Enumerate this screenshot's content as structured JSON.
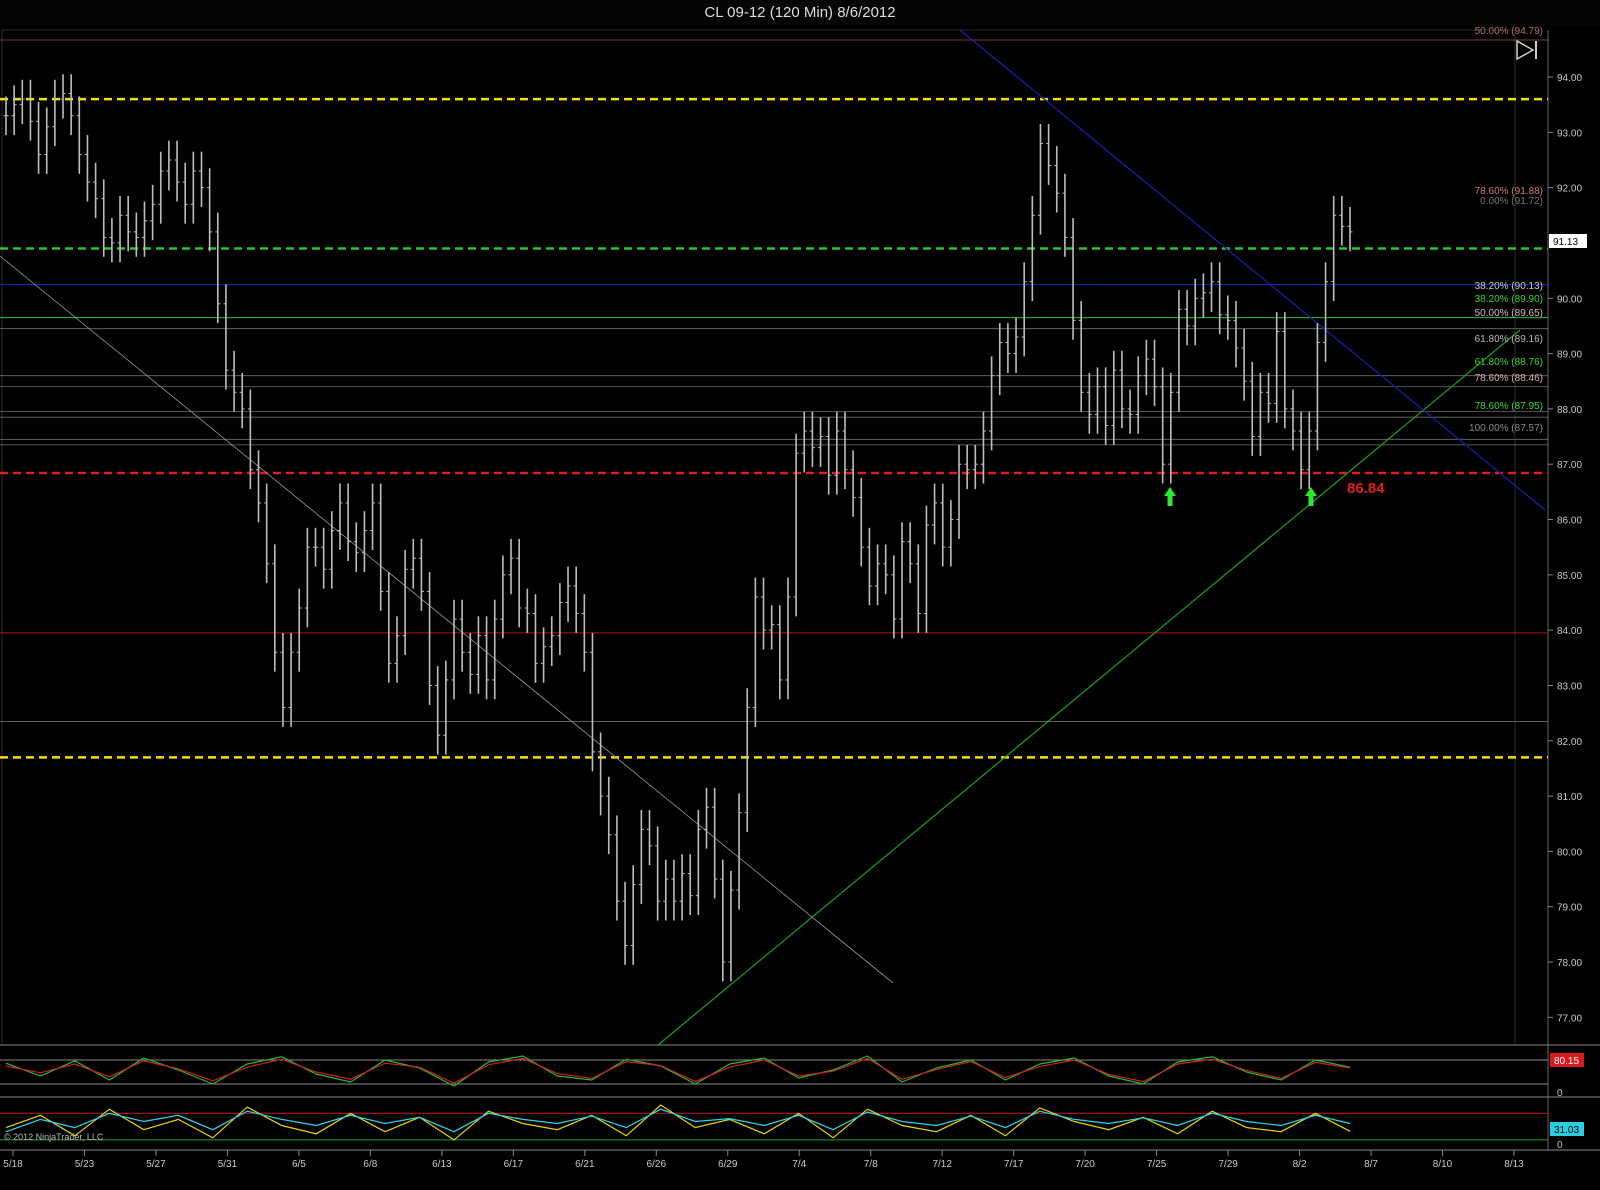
{
  "window": {
    "title": "CL 09-12 (120 Min)  8/6/2012"
  },
  "copyright": "© 2012 NinjaTrader, LLC",
  "price_label": "91.13",
  "support_label": "86.84",
  "colors": {
    "background": "#000000",
    "price_bars": "#bdbdbd",
    "resistance": "#f2e200",
    "support": "#e21b1b",
    "green_level": "#2ec22e",
    "blue_level": "#2020b8",
    "trend_up": "#19a319",
    "trend_down": "#1c1ca8",
    "stoch_k": "#2bb52b",
    "stoch_d": "#cc2222",
    "osc_yellow": "#e6d400",
    "osc_cyan": "#29d6e8"
  },
  "icons": {
    "up_arrow": "arrow-up-icon",
    "nav": "skip-forward-icon"
  },
  "chart_data": [
    {
      "type": "line",
      "title": "CL 09-12 (120 Min)  8/6/2012",
      "xlabel": "",
      "ylabel": "",
      "x_ticks": [
        "5/18",
        "5/23",
        "5/27",
        "5/31",
        "6/5",
        "6/8",
        "6/13",
        "6/17",
        "6/21",
        "6/26",
        "6/29",
        "7/4",
        "7/8",
        "7/12",
        "7/17",
        "7/20",
        "7/25",
        "7/29",
        "8/2",
        "8/7",
        "8/10",
        "8/13"
      ],
      "y_ticks": [
        "77.00",
        "78.00",
        "79.00",
        "80.00",
        "81.00",
        "82.00",
        "83.00",
        "84.00",
        "85.00",
        "86.00",
        "87.00",
        "88.00",
        "89.00",
        "90.00",
        "91.00",
        "92.00",
        "93.00",
        "94.00"
      ],
      "ylim": [
        76.5,
        94.85
      ],
      "current_price": 91.13,
      "series": [
        {
          "values": [
            93.3,
            93.5,
            93.6,
            93.2,
            92.6,
            93.1,
            93.6,
            93.7,
            93.3,
            92.6,
            92.1,
            91.8,
            91.1,
            91.0,
            91.5,
            91.2,
            91.1,
            91.4,
            91.7,
            92.3,
            92.5,
            92.1,
            91.7,
            92.3,
            92.0,
            91.2,
            89.9,
            88.7,
            88.3,
            88.0,
            86.9,
            86.3,
            85.2,
            83.6,
            82.6,
            83.6,
            84.4,
            85.5,
            85.5,
            85.1,
            85.8,
            86.3,
            85.6,
            85.4,
            85.8,
            86.3,
            84.7,
            83.4,
            83.9,
            85.1,
            85.3,
            84.7,
            83.0,
            82.1,
            83.1,
            84.2,
            83.6,
            83.2,
            83.9,
            83.1,
            84.2,
            85.0,
            85.3,
            84.4,
            84.3,
            83.4,
            83.7,
            83.9,
            84.5,
            84.8,
            84.3,
            83.6,
            81.8,
            81.0,
            80.3,
            79.1,
            78.3,
            79.4,
            80.4,
            80.1,
            79.1,
            79.5,
            79.1,
            79.6,
            79.2,
            80.4,
            80.8,
            79.5,
            78.0,
            79.3,
            80.7,
            82.6,
            84.6,
            84.0,
            84.1,
            83.1,
            84.6,
            87.2,
            87.6,
            87.3,
            87.5,
            86.8,
            87.6,
            86.9,
            86.4,
            85.5,
            84.8,
            85.2,
            85.0,
            84.2,
            85.6,
            85.2,
            84.3,
            85.9,
            86.3,
            85.5,
            86.0,
            87.0,
            86.9,
            87.0,
            87.6,
            88.6,
            89.2,
            89.0,
            89.3,
            90.3,
            91.5,
            92.8,
            92.4,
            91.9,
            91.1,
            89.6,
            88.3,
            87.9,
            88.4,
            87.7,
            88.7,
            88.0,
            87.9,
            88.6,
            88.9,
            88.4,
            87.0,
            88.3,
            89.8,
            89.5,
            90.0,
            90.1,
            90.3,
            89.7,
            89.6,
            89.1,
            88.5,
            87.5,
            88.3,
            88.1,
            89.4,
            88.0,
            87.6,
            86.9,
            87.6,
            89.2,
            90.3,
            91.5,
            91.3,
            91.2
          ]
        }
      ],
      "horizontal_levels": [
        {
          "price": 93.6,
          "style": "dashed",
          "color": "#f2e200",
          "role": "resistance"
        },
        {
          "price": 90.9,
          "style": "dashed",
          "color": "#2ec22e"
        },
        {
          "price": 90.25,
          "style": "solid",
          "color": "#2020b8"
        },
        {
          "price": 89.65,
          "style": "solid",
          "color": "#2ec22e"
        },
        {
          "price": 86.84,
          "style": "dashed",
          "color": "#e21b1b",
          "role": "support"
        },
        {
          "price": 83.95,
          "style": "solid",
          "color": "#b01515"
        },
        {
          "price": 81.7,
          "style": "dashed",
          "color": "#f2e200",
          "role": "support"
        }
      ],
      "fib_labels": [
        {
          "text": "50.00% (94.79)",
          "color": "#b07070"
        },
        {
          "text": "78.60% (91.88)",
          "color": "#d07a7a"
        },
        {
          "text": "0.00% (91.72)",
          "color": "#777777"
        },
        {
          "text": "38.20% (90.13)",
          "color": "#c9c9c9"
        },
        {
          "text": "38.20% (89.90)",
          "color": "#3bd43b"
        },
        {
          "text": "50.00% (89.65)",
          "color": "#e0b3b3"
        },
        {
          "text": "61.80% (89.16)",
          "color": "#b9b9b9"
        },
        {
          "text": "61.80% (88.76)",
          "color": "#3bd43b"
        },
        {
          "text": "78.60% (88.46)",
          "color": "#d6b0b0"
        },
        {
          "text": "78.60% (87.95)",
          "color": "#3bd43b"
        },
        {
          "text": "100.00% (87.57)",
          "color": "#888888"
        }
      ]
    },
    {
      "type": "line",
      "title": "",
      "xlabel": "",
      "ylabel": "",
      "last_value": 80.15,
      "ylim": [
        0,
        100
      ],
      "y_ticks": [
        "0"
      ],
      "series": [
        {
          "values": [
            72,
            40,
            78,
            30,
            85,
            55,
            20,
            70,
            88,
            45,
            25,
            80,
            60,
            15,
            75,
            90,
            40,
            30,
            82,
            65,
            20,
            70,
            85,
            35,
            55,
            90,
            25,
            60,
            80,
            30,
            70,
            85,
            40,
            20,
            75,
            88,
            50,
            30,
            80,
            62
          ]
        },
        {
          "values": [
            65,
            48,
            70,
            38,
            78,
            58,
            28,
            62,
            82,
            50,
            32,
            72,
            62,
            22,
            68,
            84,
            46,
            34,
            76,
            66,
            26,
            62,
            80,
            40,
            52,
            84,
            32,
            56,
            76,
            36,
            64,
            80,
            44,
            26,
            70,
            82,
            54,
            34,
            74,
            60
          ]
        }
      ]
    },
    {
      "type": "line",
      "title": "",
      "xlabel": "",
      "ylabel": "",
      "last_value": 31.03,
      "ylim": [
        0,
        100
      ],
      "y_ticks": [
        "0"
      ],
      "series": [
        {
          "values": [
            40,
            70,
            20,
            85,
            35,
            60,
            15,
            90,
            45,
            25,
            75,
            30,
            65,
            10,
            80,
            50,
            35,
            70,
            20,
            95,
            40,
            60,
            25,
            75,
            15,
            85,
            45,
            30,
            70,
            20,
            88,
            55,
            35,
            65,
            25,
            80,
            40,
            30,
            75,
            31
          ]
        },
        {
          "values": [
            30,
            60,
            40,
            75,
            55,
            70,
            35,
            80,
            60,
            45,
            70,
            50,
            65,
            30,
            75,
            60,
            50,
            68,
            40,
            85,
            55,
            62,
            45,
            70,
            35,
            78,
            55,
            45,
            68,
            40,
            80,
            60,
            50,
            64,
            45,
            75,
            55,
            45,
            70,
            50
          ]
        }
      ]
    }
  ]
}
